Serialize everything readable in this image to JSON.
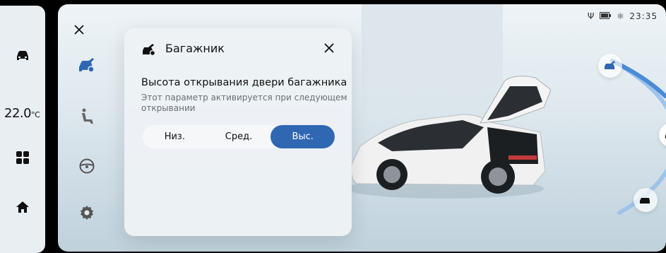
{
  "dock": {
    "temperature_value": "22.0",
    "temperature_unit": "°C",
    "icons": [
      "car-icon",
      "apps-grid-icon",
      "home-icon"
    ]
  },
  "nav": {
    "icons": [
      "close-icon",
      "car-trunk-icon",
      "seat-icon",
      "steering-wheel-icon",
      "settings-gear-icon"
    ]
  },
  "dialog": {
    "title": "Багажник",
    "heading": "Высота открывания двери багажника",
    "description": "Этот параметр активируется при следующем открывании",
    "options": [
      "Низ.",
      "Сред.",
      "Выс."
    ],
    "selected": "Выс."
  },
  "status": {
    "time": "23:35",
    "icons": [
      "usb-icon",
      "battery-icon",
      "bluetooth-icon"
    ]
  },
  "arc_control": {
    "nodes": [
      "trunk-top-icon",
      "trunk-mid-icon",
      "trunk-low-icon"
    ]
  }
}
